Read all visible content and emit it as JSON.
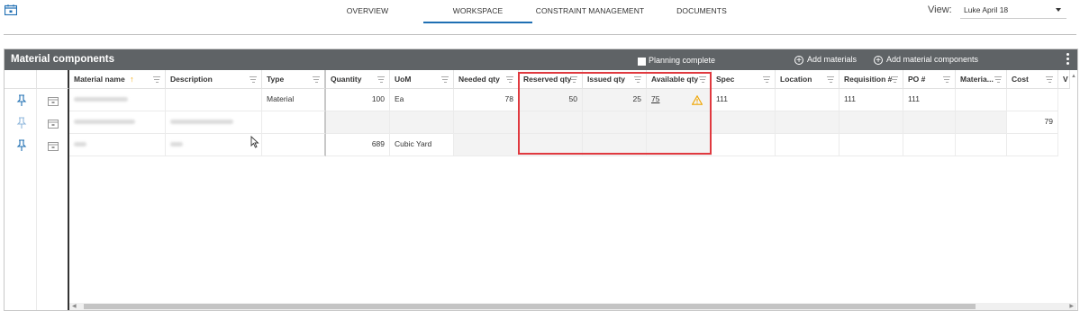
{
  "nav": {
    "tabs": [
      {
        "label": "OVERVIEW",
        "active": false
      },
      {
        "label": "WORKSPACE",
        "active": true
      },
      {
        "label": "CONSTRAINT MANAGEMENT",
        "active": false
      },
      {
        "label": "DOCUMENTS",
        "active": false
      }
    ],
    "view_label": "View:",
    "view_value": "Luke April 18"
  },
  "panel": {
    "title": "Material components",
    "planning_complete_label": "Planning complete",
    "planning_complete_checked": false,
    "add_materials_label": "Add materials",
    "add_material_components_label": "Add material components"
  },
  "columns": [
    {
      "label": "Material name",
      "sorted": "ascending"
    },
    {
      "label": "Description"
    },
    {
      "label": "Type"
    },
    {
      "label": "Quantity"
    },
    {
      "label": "UoM"
    },
    {
      "label": "Needed qty"
    },
    {
      "label": "Reserved qty"
    },
    {
      "label": "Issued qty"
    },
    {
      "label": "Available qty"
    },
    {
      "label": "Spec"
    },
    {
      "label": "Location"
    },
    {
      "label": "Requisition #"
    },
    {
      "label": "PO #"
    },
    {
      "label": "Materia..."
    },
    {
      "label": "Cost"
    },
    {
      "label": "V"
    }
  ],
  "rows": [
    {
      "name": "",
      "description": "",
      "type": "Material",
      "quantity": "100",
      "uom": "Ea",
      "needed_qty": "78",
      "reserved_qty": "50",
      "issued_qty": "25",
      "available_qty": "75",
      "available_warning": true,
      "spec": "111",
      "location": "",
      "requisition": "111",
      "po": "111",
      "material": "",
      "cost": ""
    },
    {
      "name": "",
      "description": "",
      "type": "",
      "quantity": "",
      "uom": "",
      "needed_qty": "",
      "reserved_qty": "",
      "issued_qty": "",
      "available_qty": "",
      "available_warning": false,
      "spec": "",
      "location": "",
      "requisition": "",
      "po": "",
      "material": "",
      "cost": "79"
    },
    {
      "name": "",
      "description": "",
      "type": "",
      "quantity": "689",
      "uom": "Cubic Yard",
      "needed_qty": "",
      "reserved_qty": "",
      "issued_qty": "",
      "available_qty": "",
      "available_warning": false,
      "spec": "",
      "location": "",
      "requisition": "",
      "po": "",
      "material": "",
      "cost": ""
    }
  ],
  "colors": {
    "header_bar": "#5f6366",
    "active_tab": "#1f6fb3",
    "highlight_box": "#e0393f",
    "warning": "#f0a500",
    "sort_arrow": "#f0a500"
  }
}
